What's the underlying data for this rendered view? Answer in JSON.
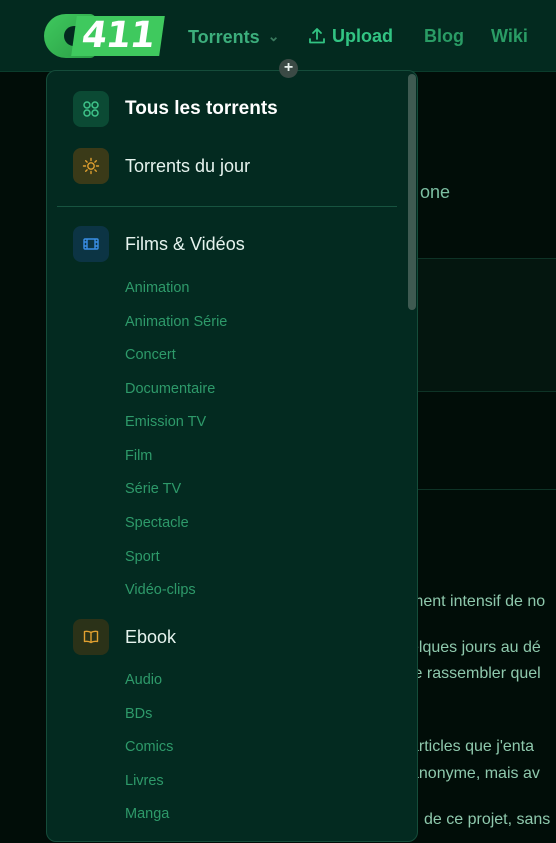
{
  "header": {
    "logo_text": "C411",
    "nav": {
      "torrents": "Torrents",
      "upload": "Upload",
      "blog": "Blog",
      "wiki": "Wiki"
    }
  },
  "background": {
    "title_fragment": "one",
    "lines": [
      "ment intensif de no",
      "elques jours au dé",
      "le rassembler quel",
      "articles que j'enta",
      "anonyme, mais av",
      "de ce projet, sans"
    ]
  },
  "dropdown": {
    "all_torrents": "Tous les torrents",
    "todays_torrents": "Torrents du jour",
    "categories": [
      {
        "label": "Films & Vidéos",
        "icon": "film-icon",
        "subs": [
          "Animation",
          "Animation Série",
          "Concert",
          "Documentaire",
          "Emission TV",
          "Film",
          "Série TV",
          "Spectacle",
          "Sport",
          "Vidéo-clips"
        ]
      },
      {
        "label": "Ebook",
        "icon": "book-icon",
        "subs": [
          "Audio",
          "BDs",
          "Comics",
          "Livres",
          "Manga"
        ]
      }
    ]
  },
  "colors": {
    "accent_green": "#2fb86d",
    "dropdown_bg": "#032a20",
    "sun_icon": "#e0a030",
    "film_icon": "#3a8ee6",
    "book_icon": "#e0a030"
  }
}
